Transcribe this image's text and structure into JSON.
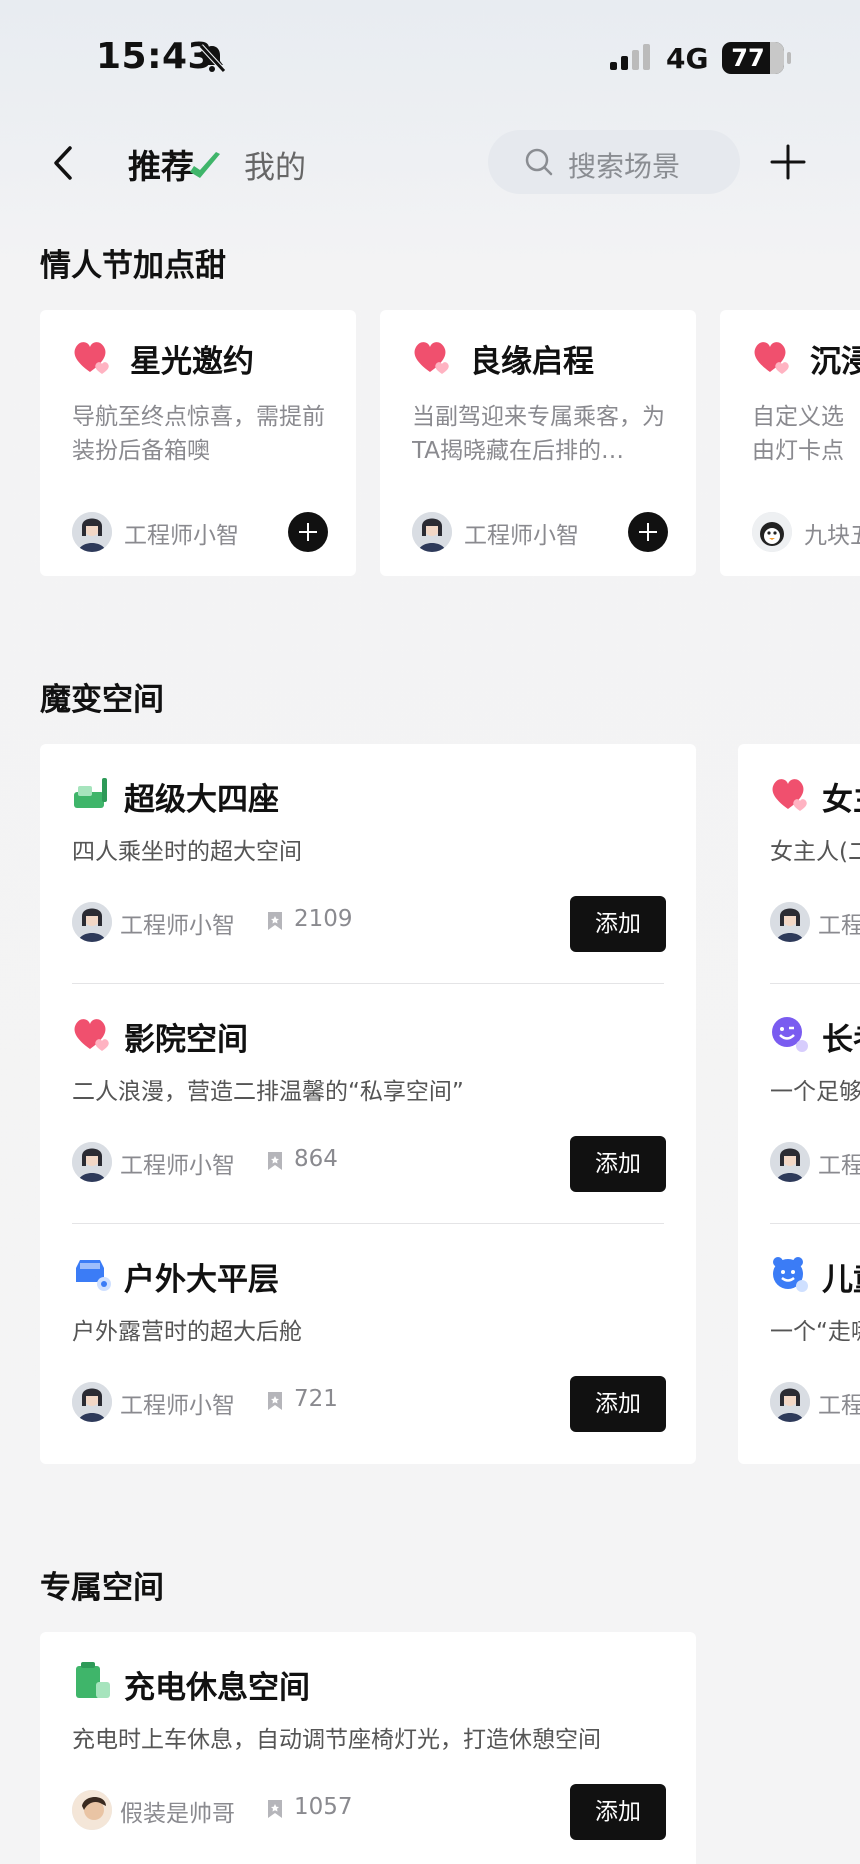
{
  "status_bar": {
    "time": "15:43",
    "network": "4G",
    "battery": "77"
  },
  "header": {
    "tab_recommended": "推荐",
    "tab_mine": "我的",
    "search_placeholder": "搜索场景"
  },
  "section_valentine": {
    "title": "情人节加点甜",
    "cards": [
      {
        "title": "星光邀约",
        "desc": "导航至终点惊喜，需提前装扮后备箱噢",
        "author": "工程师小智",
        "icon": "heart-icon"
      },
      {
        "title": "良缘启程",
        "desc": "当副驾迎来专属乘客，为TA揭晓藏在后排的…",
        "author": "工程师小智",
        "icon": "heart-icon"
      },
      {
        "title": "沉浸",
        "desc": "自定义选由灯卡点跳色",
        "author": "九块五",
        "icon": "heart-icon"
      }
    ]
  },
  "section_transform": {
    "title": "魔变空间",
    "items": [
      {
        "title": "超级大四座",
        "desc": "四人乘坐时的超大空间",
        "author": "工程师小智",
        "count": "2109",
        "add_label": "添加",
        "icon": "seat-icon"
      },
      {
        "title": "影院空间",
        "desc": "二人浪漫，营造二排温馨的“私享空间”",
        "author": "工程师小智",
        "count": "864",
        "add_label": "添加",
        "icon": "heart-icon"
      },
      {
        "title": "户外大平层",
        "desc": "户外露营时的超大后舱",
        "author": "工程师小智",
        "count": "721",
        "add_label": "添加",
        "icon": "car-icon"
      }
    ],
    "peek_items": [
      {
        "title": "女主",
        "desc": "女主人(二",
        "author": "工程",
        "icon": "heart-icon"
      },
      {
        "title": "长考",
        "desc": "一个足够",
        "author": "工程",
        "icon": "smile-icon"
      },
      {
        "title": "儿童",
        "desc": "一个“走哪",
        "author": "工程",
        "icon": "child-icon"
      }
    ]
  },
  "section_exclusive": {
    "title": "专属空间",
    "items": [
      {
        "title": "充电休息空间",
        "desc": "充电时上车休息，自动调节座椅灯光，打造休憩空间",
        "author": "假装是帅哥",
        "count": "1057",
        "add_label": "添加",
        "icon": "charging-icon"
      }
    ]
  },
  "colors": {
    "accent_green": "#3fb56a",
    "heart_pink": "#f0506e",
    "blue": "#3b7cf6",
    "purple": "#7a5cf0"
  }
}
